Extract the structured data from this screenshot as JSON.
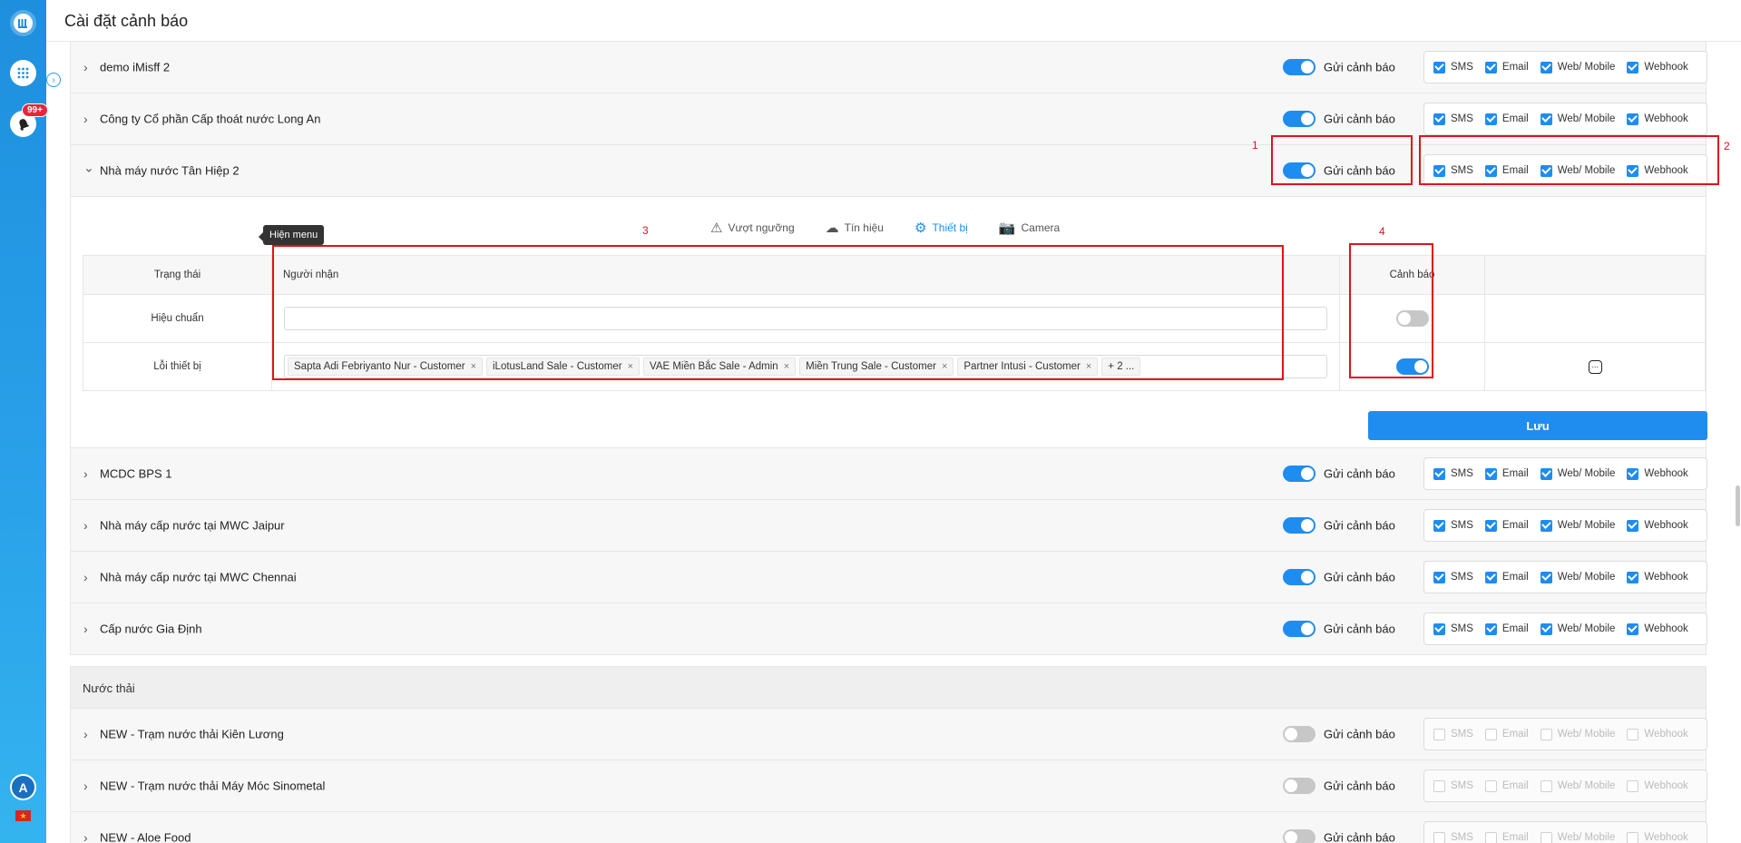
{
  "header": {
    "title": "Cài đặt cảnh báo"
  },
  "nav": {
    "badge": "99+",
    "avatar": "A",
    "flag": "★"
  },
  "channels": [
    "SMS",
    "Email",
    "Web/ Mobile",
    "Webhook"
  ],
  "toggle_label": "Gửi cảnh báo",
  "rows_top": [
    {
      "name": "demo iMisff 2",
      "chevron": ">",
      "enabled": true
    },
    {
      "name": "Công ty Cổ phần Cấp thoát nước Long An",
      "chevron": ">",
      "enabled": true
    },
    {
      "name": "Nhà máy nước Tân Hiệp 2",
      "chevron": "v",
      "enabled": true
    }
  ],
  "tabs": [
    {
      "label": "Vượt ngưỡng",
      "icon": "warning-icon",
      "glyph": "⚠"
    },
    {
      "label": "Tín hiệu",
      "icon": "cloud-icon",
      "glyph": "☁"
    },
    {
      "label": "Thiết bị",
      "icon": "device-gear-icon",
      "glyph": "⚙"
    },
    {
      "label": "Camera",
      "icon": "camera-icon",
      "glyph": "📷"
    }
  ],
  "table": {
    "headers": {
      "status": "Trạng thái",
      "recipients": "Người nhận",
      "alert": "Cảnh báo"
    },
    "rows": [
      {
        "status": "Hiệu chuẩn",
        "recipients": [],
        "alert": false
      },
      {
        "status": "Lỗi thiết bị",
        "recipients": [
          "Sapta Adi Febriyanto Nur - Customer",
          "iLotusLand Sale - Customer",
          "VAE Miền Bắc Sale - Admin",
          "Miền Trung Sale - Customer",
          "Partner Intusi - Customer"
        ],
        "more": "+ 2 ...",
        "alert": true
      }
    ]
  },
  "save_label": "Lưu",
  "tooltip": "Hiện menu",
  "rows_mid": [
    {
      "name": "MCDC BPS 1",
      "enabled": true
    },
    {
      "name": "Nhà máy cấp nước tại MWC Jaipur",
      "enabled": true
    },
    {
      "name": "Nhà máy cấp nước tại MWC Chennai",
      "enabled": true
    },
    {
      "name": "Cấp nước Gia Định",
      "enabled": true
    }
  ],
  "group2": {
    "title": "Nước thải"
  },
  "rows_bottom": [
    {
      "name": "NEW - Trạm nước thải Kiên Lương",
      "enabled": false
    },
    {
      "name": "NEW - Trạm nước thải Máy Móc Sinometal",
      "enabled": false
    },
    {
      "name": "NEW - Aloe Food",
      "enabled": false
    }
  ],
  "annotations": [
    "1",
    "2",
    "3",
    "4"
  ],
  "colors": {
    "accent": "#1f8cf0",
    "annotation": "#e3101e",
    "nav": "#2aa2ea"
  }
}
